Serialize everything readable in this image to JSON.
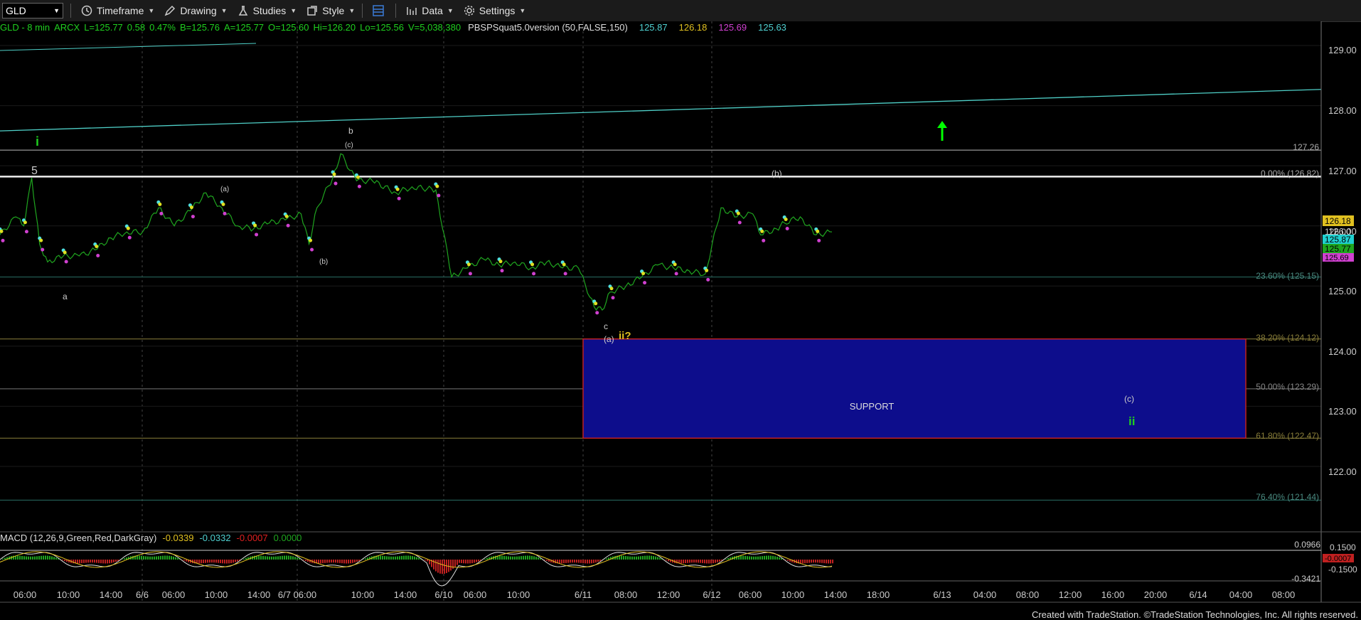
{
  "toolbar": {
    "symbol": "GLD",
    "timeframe": "Timeframe",
    "drawing": "Drawing",
    "studies": "Studies",
    "style": "Style",
    "data": "Data",
    "settings": "Settings"
  },
  "header": {
    "sym": "GLD - 8 min",
    "exch": "ARCX",
    "last": "L=125.77",
    "chg": "0.58",
    "pct": "0.47%",
    "bid": "B=125.76",
    "ask": "A=125.77",
    "open": "O=125.60",
    "high": "Hi=126.20",
    "low": "Lo=125.56",
    "vol": "V=5,038,380",
    "study": "PBSPSquat5.0version (50,FALSE,150)",
    "v1": "125.87",
    "v2": "126.18",
    "v3": "125.69",
    "v4": "125.63"
  },
  "macd_header": {
    "name": "MACD (12,26,9,Green,Red,DarkGray)",
    "v1": "-0.0339",
    "v2": "-0.0332",
    "v3": "-0.0007",
    "v4": "0.0000"
  },
  "chart_data": {
    "type": "line",
    "title": "GLD - 8 min",
    "y_axis": {
      "ticks": [
        "129.00",
        "128.00",
        "127.00",
        "126.00",
        "125.00",
        "124.00",
        "123.00",
        "122.00"
      ],
      "range": [
        121.0,
        129.5
      ]
    },
    "x_axis": {
      "labels": [
        "06:00",
        "10:00",
        "14:00",
        "6/6",
        "06:00",
        "10:00",
        "14:00",
        "6/7 06:00",
        "10:00",
        "14:00",
        "6/10",
        "06:00",
        "10:00",
        "6/11",
        "08:00",
        "12:00",
        "6/12",
        "06:00",
        "10:00",
        "14:00",
        "18:00",
        "6/13",
        "04:00",
        "08:00",
        "12:00",
        "16:00",
        "20:00",
        "6/14",
        "04:00",
        "08:00"
      ]
    },
    "price_path": [
      [
        0,
        125.85
      ],
      [
        2,
        126.15
      ],
      [
        3,
        126.0
      ],
      [
        4,
        126.8
      ],
      [
        5,
        125.7
      ],
      [
        6,
        125.4
      ],
      [
        8,
        125.5
      ],
      [
        10,
        125.5
      ],
      [
        12,
        125.6
      ],
      [
        14,
        125.8
      ],
      [
        16,
        125.9
      ],
      [
        18,
        125.9
      ],
      [
        20,
        126.3
      ],
      [
        22,
        126.0
      ],
      [
        24,
        126.25
      ],
      [
        26,
        126.55
      ],
      [
        28,
        126.3
      ],
      [
        30,
        126.0
      ],
      [
        32,
        125.95
      ],
      [
        34,
        126.05
      ],
      [
        36,
        126.1
      ],
      [
        38,
        126.2
      ],
      [
        39,
        125.7
      ],
      [
        40,
        126.3
      ],
      [
        42,
        126.8
      ],
      [
        43,
        127.2
      ],
      [
        45,
        126.75
      ],
      [
        47,
        126.75
      ],
      [
        50,
        126.55
      ],
      [
        52,
        126.65
      ],
      [
        55,
        126.6
      ],
      [
        57,
        125.15
      ],
      [
        59,
        125.3
      ],
      [
        61,
        125.45
      ],
      [
        63,
        125.35
      ],
      [
        65,
        125.4
      ],
      [
        67,
        125.3
      ],
      [
        69,
        125.4
      ],
      [
        71,
        125.3
      ],
      [
        73,
        125.3
      ],
      [
        75,
        124.65
      ],
      [
        76,
        124.6
      ],
      [
        77,
        124.9
      ],
      [
        79,
        125.0
      ],
      [
        81,
        125.15
      ],
      [
        83,
        125.35
      ],
      [
        85,
        125.3
      ],
      [
        87,
        125.25
      ],
      [
        89,
        125.2
      ],
      [
        91,
        126.3
      ],
      [
        93,
        126.15
      ],
      [
        95,
        126.2
      ],
      [
        96,
        125.85
      ],
      [
        98,
        125.95
      ],
      [
        99,
        126.05
      ],
      [
        101,
        126.15
      ],
      [
        103,
        125.85
      ],
      [
        105,
        125.9
      ]
    ],
    "horizontal_lines": [
      {
        "label": "127.26",
        "value": 127.26
      },
      {
        "label": "0.00% (126.82)",
        "value": 126.82
      },
      {
        "label": "23.60% (125.15)",
        "value": 125.15
      },
      {
        "label": "38.20% (124.12)",
        "value": 124.12
      },
      {
        "label": "50.00% (123.29)",
        "value": 123.29
      },
      {
        "label": "61.80% (122.47)",
        "value": 122.47
      },
      {
        "label": "76.40% (121.44)",
        "value": 121.44
      }
    ],
    "trendline": {
      "from": 127.58,
      "to": 128.27
    },
    "support_zone": {
      "label": "SUPPORT",
      "top": 124.12,
      "bottom": 122.47
    },
    "price_markers": [
      "126.18",
      "126.00",
      "125.87",
      "125.77",
      "125.69"
    ],
    "wave_labels": [
      "i",
      "5",
      "a",
      "(a)",
      "(b)",
      "b",
      "(c)",
      "c",
      "(a)",
      "ii?",
      "(b)",
      "(c)",
      "ii"
    ],
    "macd": {
      "axis": [
        "0.0966",
        "0.1500",
        "-0.0007",
        "-0.1500",
        "-0.3421"
      ]
    }
  },
  "footer": "Created with TradeStation. ©TradeStation Technologies, Inc. All rights reserved.",
  "colors": {
    "bg": "#000000",
    "price": "#1fa51f",
    "trend": "#4fd0c8",
    "support": "#0d0d8c",
    "fib": "#8a7f3a",
    "arrow": "#00ff00"
  }
}
